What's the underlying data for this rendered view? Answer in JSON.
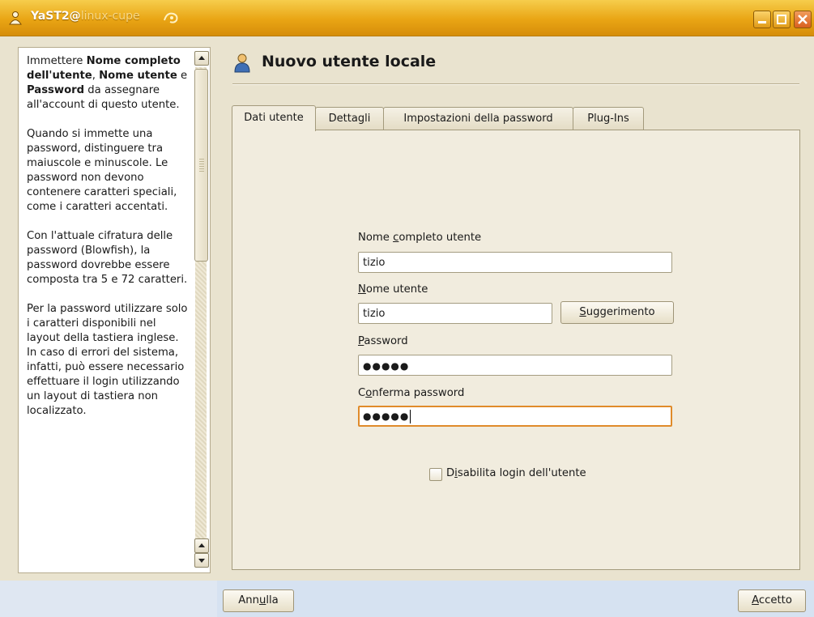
{
  "window": {
    "app": "YaST2@",
    "host": "linux-cupe"
  },
  "help": {
    "paragraphs": [
      "Immettere <b>Nome completo dell'utente</b>, <b>Nome utente</b> e <b>Password</b> da assegnare all'account di questo utente.",
      "Quando si immette una password, distinguere tra maiuscole e minuscole. Le password non devono contenere caratteri speciali, come i caratteri accentati.",
      "Con l'attuale cifratura delle password (Blowfish), la password dovrebbe essere composta tra 5 e 72 caratteri.",
      "Per la password utilizzare solo i caratteri disponibili nel layout della tastiera inglese. In caso di errori del sistema, infatti, può essere necessario effettuare il login utilizzando un layout di tastiera non localizzato."
    ]
  },
  "dialog": {
    "title": "Nuovo utente locale"
  },
  "tabs": [
    {
      "label": "Dati utente",
      "active": true
    },
    {
      "label": "Dettagli",
      "active": false
    },
    {
      "label": "Impostazioni della password",
      "active": false
    },
    {
      "label": "Plug-Ins",
      "active": false
    }
  ],
  "form": {
    "fullname": {
      "label_pre": "Nome ",
      "label_key": "c",
      "label_post": "ompleto utente",
      "value": "tizio"
    },
    "username": {
      "label_pre": "",
      "label_key": "N",
      "label_post": "ome utente",
      "value": "tizio"
    },
    "suggest_button": {
      "pre": "",
      "key": "S",
      "post": "uggerimento"
    },
    "password": {
      "label_pre": "",
      "label_key": "P",
      "label_post": "assword",
      "value": "●●●●●"
    },
    "confirm": {
      "label_pre": "C",
      "label_key": "o",
      "label_post": "nferma password",
      "value": "●●●●●"
    },
    "disable_login": {
      "pre": "D",
      "key": "i",
      "post": "sabilita login dell'utente",
      "checked": false
    }
  },
  "footer": {
    "cancel": {
      "pre": "Ann",
      "key": "u",
      "post": "lla"
    },
    "accept": {
      "pre": "",
      "key": "A",
      "post": "ccetto"
    }
  }
}
